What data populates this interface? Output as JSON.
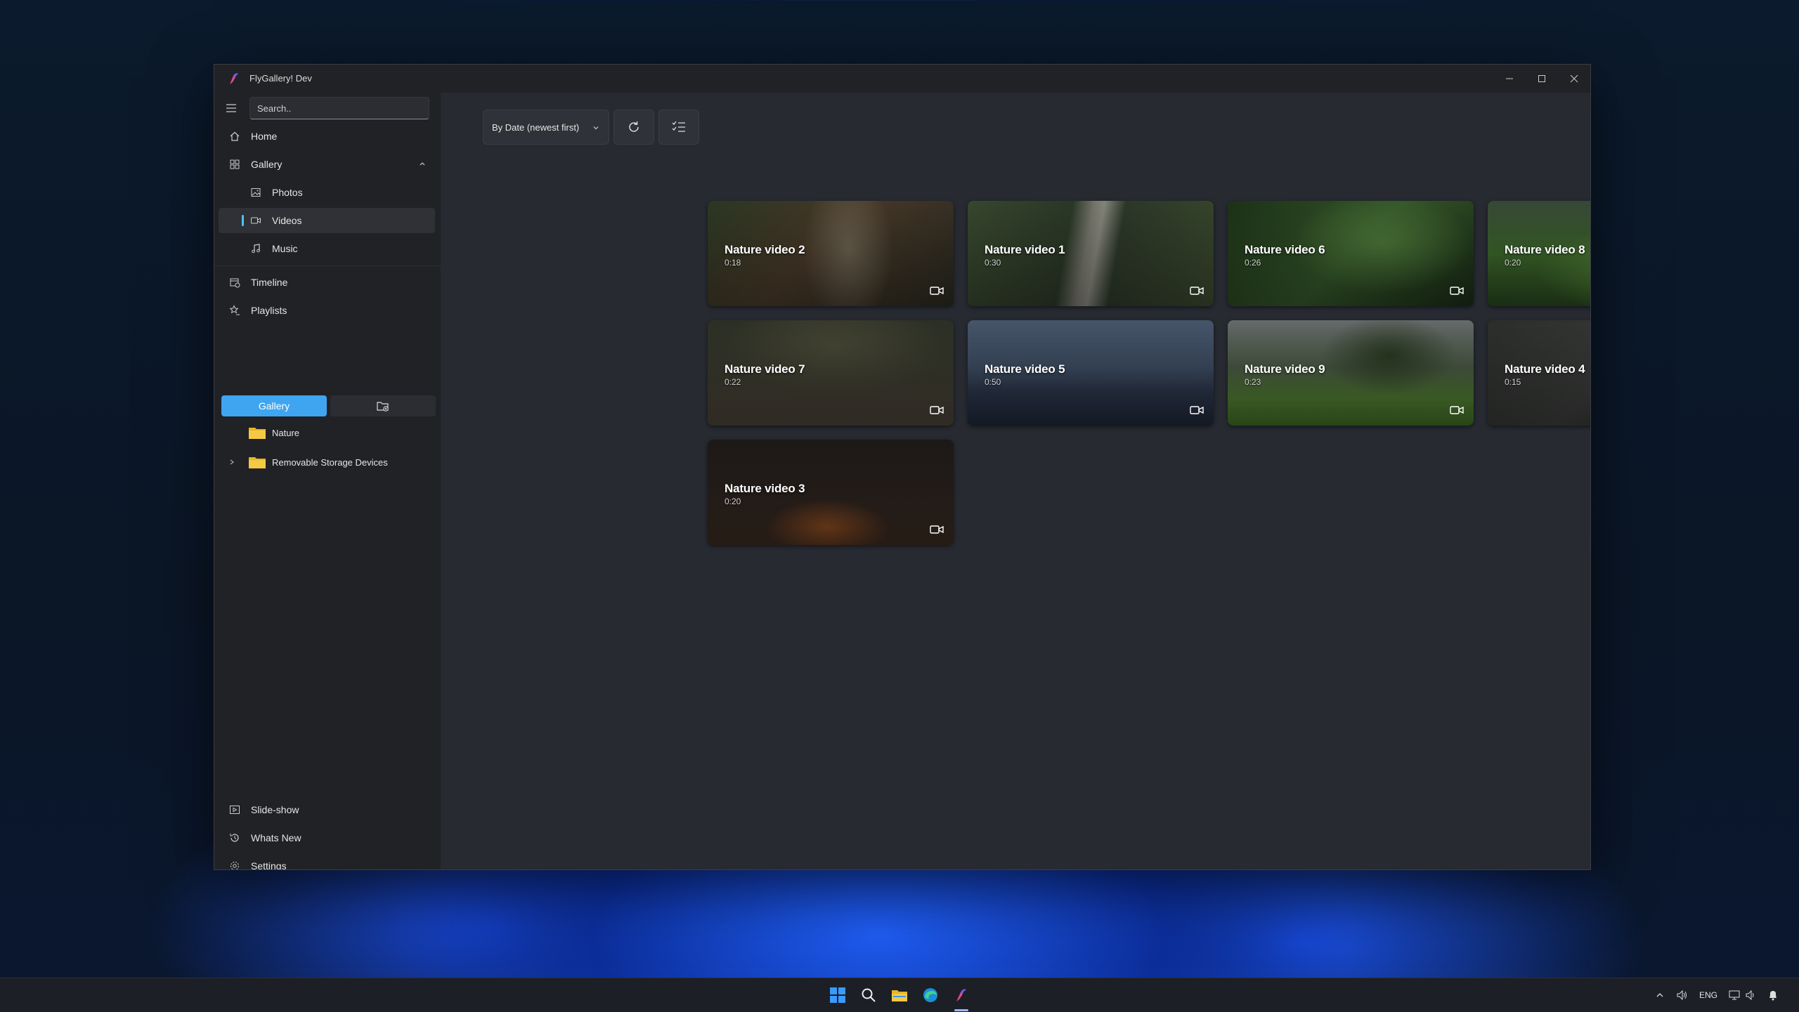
{
  "window": {
    "title": "FlyGallery! Dev"
  },
  "search": {
    "placeholder": "Search.."
  },
  "nav": {
    "home": "Home",
    "gallery": "Gallery",
    "photos": "Photos",
    "videos": "Videos",
    "music": "Music",
    "timeline": "Timeline",
    "playlists": "Playlists",
    "slideshow": "Slide-show",
    "whats_new": "Whats New",
    "settings": "Settings"
  },
  "playlists_panel": {
    "active_tab": "Gallery",
    "folders": [
      "Nature",
      "Removable Storage Devices"
    ]
  },
  "toolbar": {
    "sort_label": "By Date (newest first)"
  },
  "videos": [
    {
      "title": "Nature video 2",
      "duration": "0:18"
    },
    {
      "title": "Nature video 1",
      "duration": "0:30"
    },
    {
      "title": "Nature video 6",
      "duration": "0:26"
    },
    {
      "title": "Nature video 8",
      "duration": "0:20"
    },
    {
      "title": "Nature video 7",
      "duration": "0:22"
    },
    {
      "title": "Nature video 5",
      "duration": "0:50"
    },
    {
      "title": "Nature video 9",
      "duration": "0:23"
    },
    {
      "title": "Nature video 4",
      "duration": "0:15"
    },
    {
      "title": "Nature video 3",
      "duration": "0:20"
    }
  ],
  "taskbar": {
    "language": "ENG"
  },
  "colors": {
    "accent": "#3fa5f0",
    "window_bg": "#272a31",
    "sidebar_bg": "#202226"
  }
}
